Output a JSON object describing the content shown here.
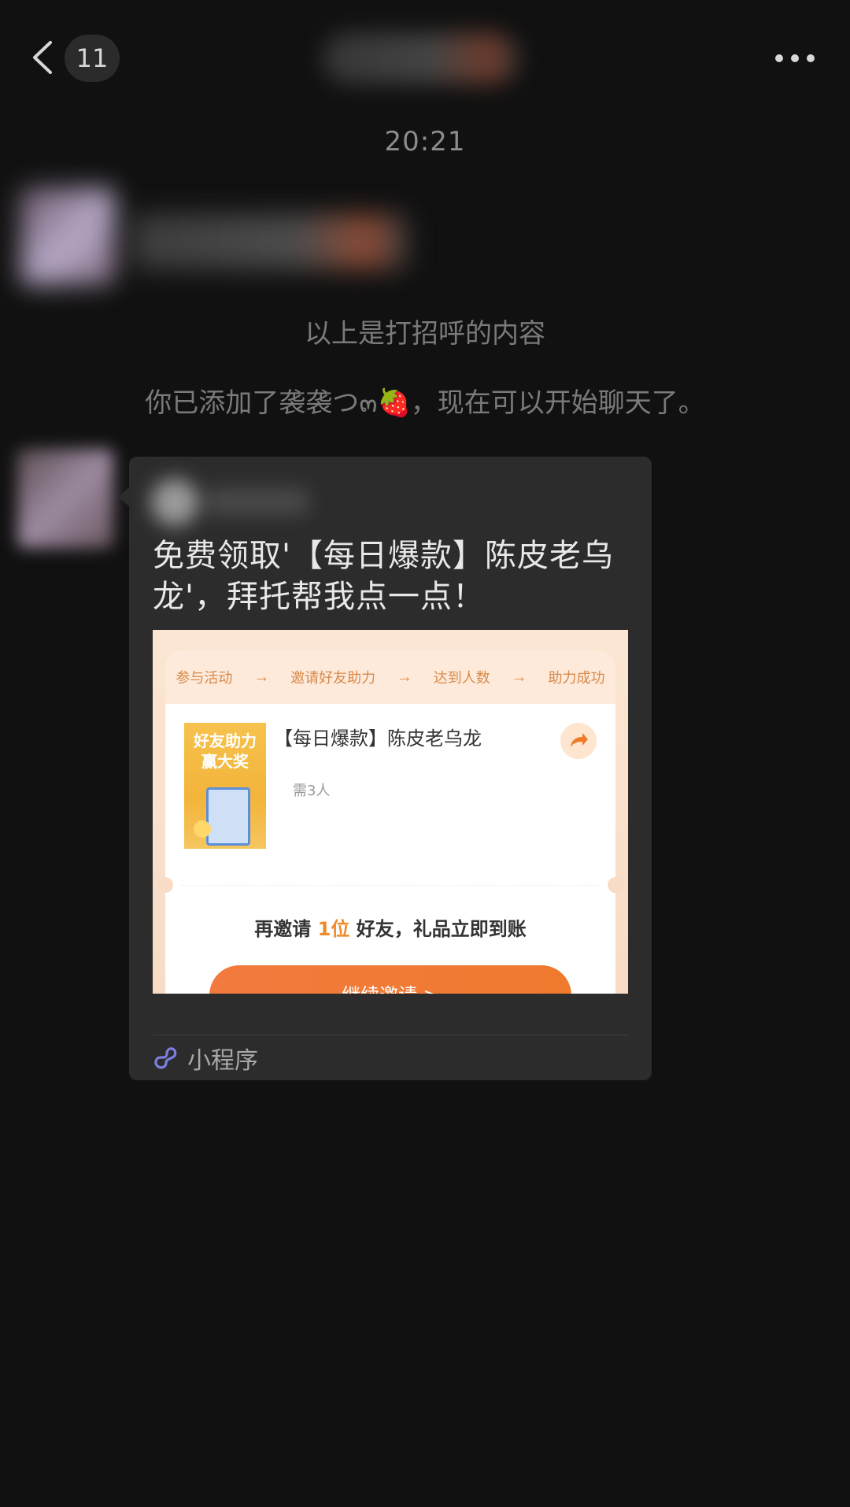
{
  "nav": {
    "unread_count": "11",
    "more_icon": "ellipsis-icon",
    "back_icon": "chevron-left-icon"
  },
  "chat": {
    "timestamp": "20:21",
    "greeting_note": "以上是打招呼的内容",
    "added_note": "你已添加了袭袭つ๓🍓，现在可以开始聊天了。"
  },
  "card": {
    "title": "免费领取'【每日爆款】陈皮老乌龙'，拜托帮我点一点！",
    "footer_label": "小程序",
    "footer_icon": "mini-program-icon",
    "preview": {
      "steps": [
        "参与活动",
        "邀请好友助力",
        "达到人数",
        "助力成功"
      ],
      "step_arrow": "→",
      "poster_text": "好友助力\n赢大奖",
      "product_title": "【每日爆款】陈皮老乌龙",
      "need_text": "需3人",
      "invite_prefix": "再邀请 ",
      "invite_count": "1位",
      "invite_suffix": " 好友，礼品立即到账",
      "invite_button": "继续邀请 >"
    }
  },
  "colors": {
    "background": "#111111",
    "card": "#2c2c2c",
    "accent_orange": "#ee8a2a",
    "mini_program_purple": "#7b7fe0"
  }
}
